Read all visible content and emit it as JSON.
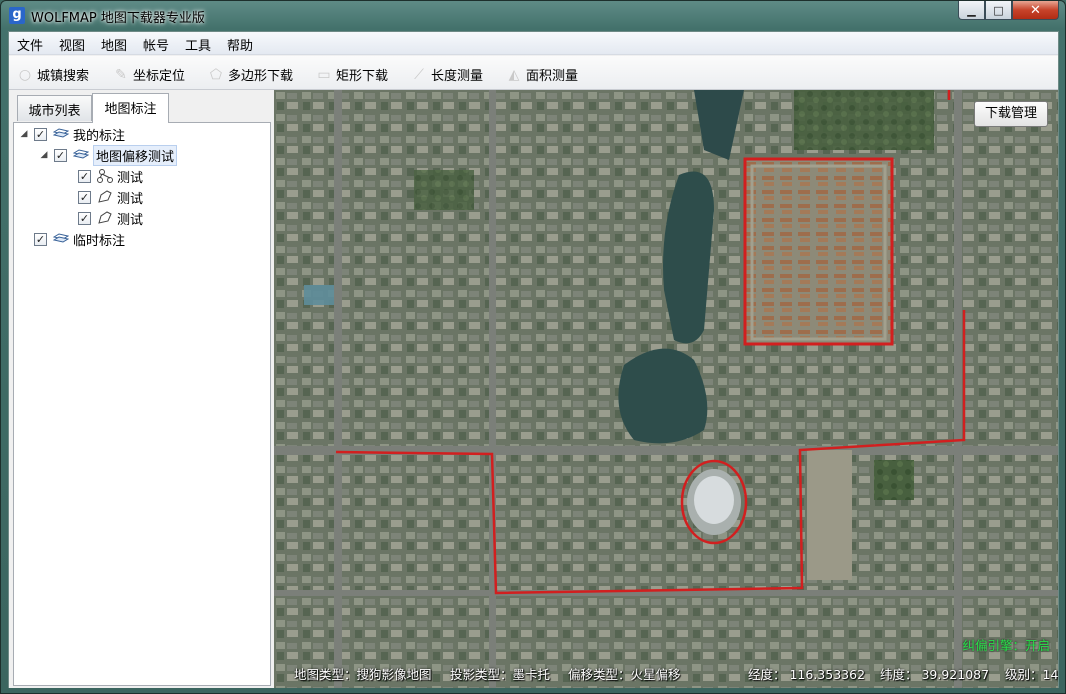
{
  "window": {
    "title": "WOLFMAP 地图下载器专业版",
    "app_icon": "g"
  },
  "menu": [
    "文件",
    "视图",
    "地图",
    "帐号",
    "工具",
    "帮助"
  ],
  "toolbar": {
    "city_search": "城镇搜索",
    "coord_locate": "坐标定位",
    "polygon_download": "多边形下载",
    "rect_download": "矩形下载",
    "length_measure": "长度测量",
    "area_measure": "面积测量"
  },
  "tabs": {
    "city_list": "城市列表",
    "map_annotations": "地图标注"
  },
  "tree": {
    "my_annotations": "我的标注",
    "offset_test": "地图偏移测试",
    "child1": "测试",
    "child2": "测试",
    "child3": "测试",
    "temp_annotations": "临时标注"
  },
  "map": {
    "download_manager": "下载管理",
    "map_type": "地图类型：搜狗影像地图",
    "projection": "投影类型：墨卡托",
    "offset_type": "偏移类型：火星偏移",
    "longitude": "经度：  116.353362",
    "latitude": "纬度：  39.921087",
    "level": "级别：14",
    "engine": "纠偏引擎：开启"
  },
  "colors": {
    "annotation_red": "#d21f1f",
    "engine_green": "#28e04a"
  }
}
